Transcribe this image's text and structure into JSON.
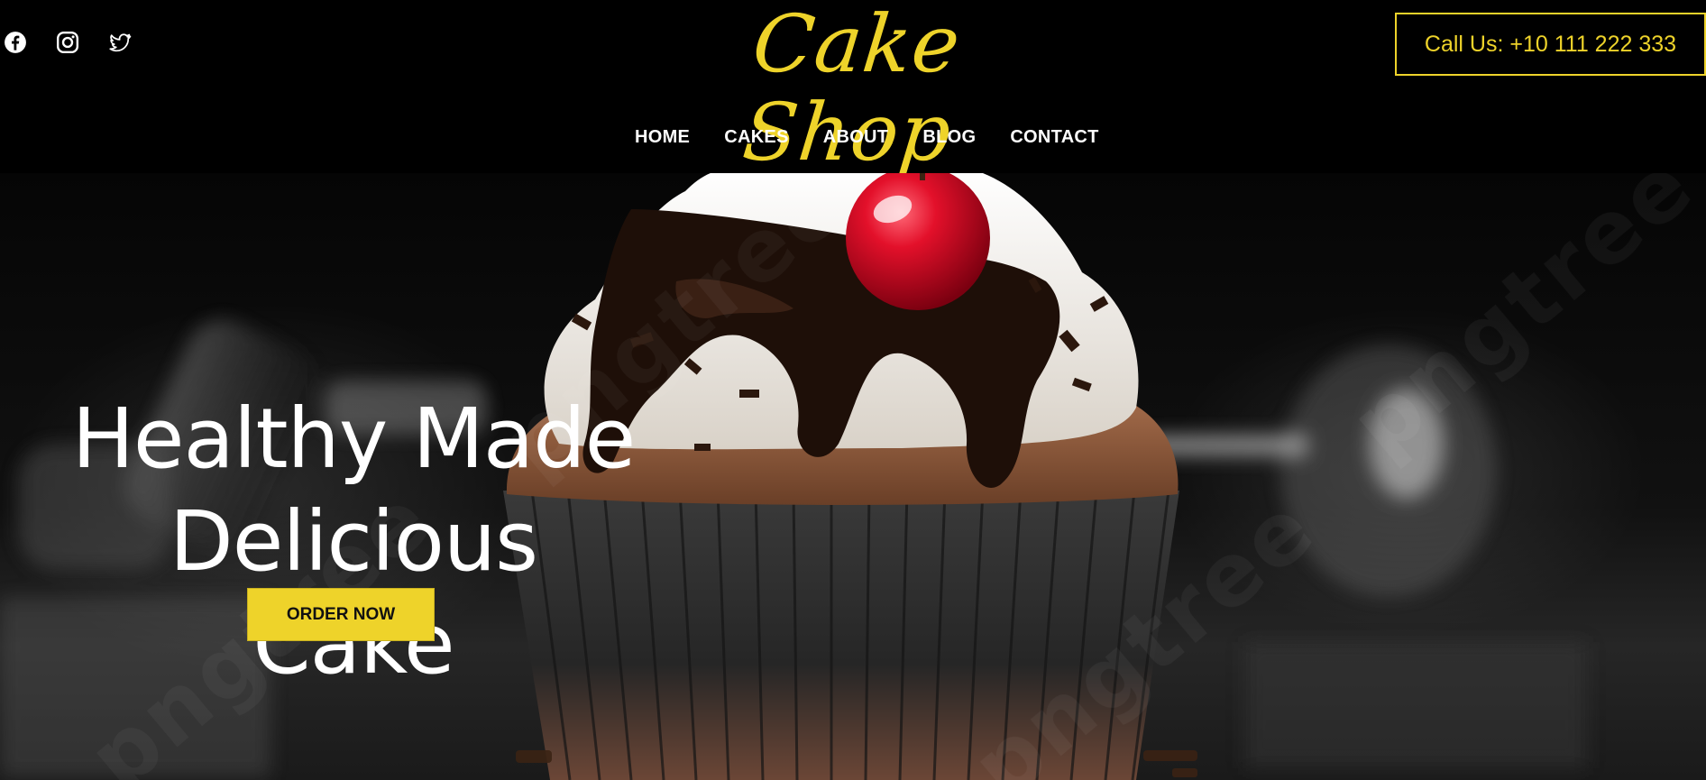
{
  "header": {
    "logo_text": "Cake Shop",
    "call_button_label": "Call Us: +10 111 222 333",
    "social_icons": [
      "facebook-icon",
      "instagram-icon",
      "twitter-icon"
    ]
  },
  "nav": {
    "items": [
      {
        "label": "HOME"
      },
      {
        "label": "CAKES"
      },
      {
        "label": "ABOUT"
      },
      {
        "label": "BLOG"
      },
      {
        "label": "CONTACT"
      }
    ]
  },
  "hero": {
    "headline_line1": "Healthy Made",
    "headline_line2": "Delicious Cake",
    "order_button_label": "ORDER NOW"
  },
  "colors": {
    "accent": "#eed32a",
    "background": "#000000",
    "text": "#ffffff"
  }
}
